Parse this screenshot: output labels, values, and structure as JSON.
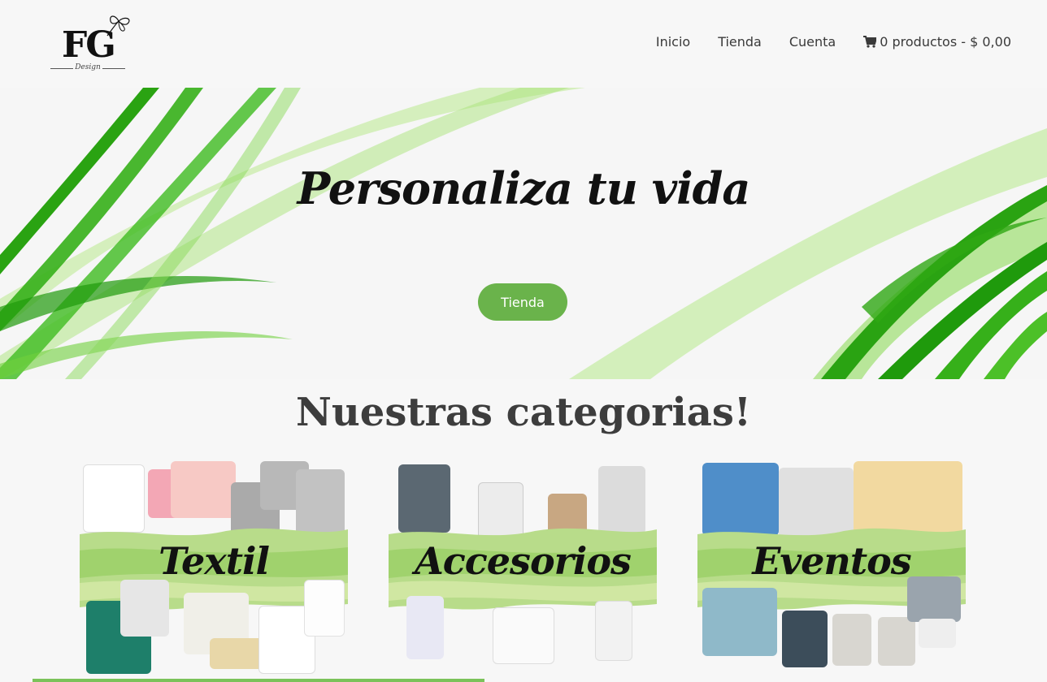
{
  "logo": {
    "mark": "FG",
    "subtitle": "Design"
  },
  "nav": {
    "items": [
      "Inicio",
      "Tienda",
      "Cuenta"
    ],
    "cart_text": "0 productos - $ 0,00"
  },
  "hero": {
    "title": "Personaliza tu vida",
    "button_label": "Tienda"
  },
  "categories": {
    "heading": "Nuestras categorias!",
    "items": [
      {
        "label": "Textil"
      },
      {
        "label": "Accesorios"
      },
      {
        "label": "Eventos"
      }
    ]
  },
  "colors": {
    "accent": "#6ab34b",
    "wave_dark": "#2fa814",
    "wave_light": "#9ee06a",
    "band": "#b8dc8a"
  },
  "icons": [
    "butterfly-icon",
    "cart-icon"
  ]
}
